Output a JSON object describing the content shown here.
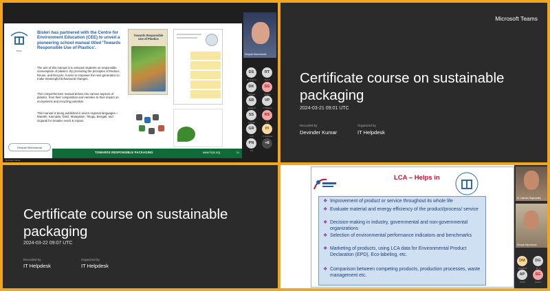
{
  "tiles": {
    "top_left": {
      "slide": {
        "logo_caption": "Bisleri",
        "headline": "Bisleri has partnered with the Centre for Environment Education (CEE) to unveil a pioneering school manual titled 'Towards Responsible Use of Plastics'.",
        "paragraph_1": "The aim of this manual is to educate students on responsible consumption of plastics. By promoting the principles of Reduce, Reuse, and Recycle, it aims to empower the next generation to make meaningful behavioural changes.",
        "paragraph_2": "This comprehensive manual delves into various aspects of plastics, from their composition and varieties to their impact on ecosystems and recycling potential.",
        "paragraph_3": "This manual is being published in seven regional languages—Marathi, Kannada, Tamil, Malayalam, Telugu, Bengali, and Gujarati for broader reach & impact.",
        "book_title": "Towards Responsible Use of Plastics",
        "presenter_tag": "Deepak Manchanda",
        "footer_title": "TOWARDS RESPONSIBLE PACKAGING",
        "footer_url": "www.f-ips.org",
        "footer_page": "34"
      },
      "camera_label": "Deepak Manchanda",
      "bottom_label": "Devinder Kumar",
      "participants": [
        {
          "initials": "DS",
          "color": "#d9d9d9",
          "text": "#333333",
          "sub": "Dr. Sharma"
        },
        {
          "initials": "RT",
          "color": "#d9d9d9",
          "text": "#333333",
          "sub": "Ravi T"
        },
        {
          "initials": "DK",
          "color": "#d9d9d9",
          "text": "#333333",
          "sub": "Devinder"
        },
        {
          "initials": "SG",
          "color": "#f2a7a7",
          "text": "#a31b1b",
          "sub": "Sunil G"
        },
        {
          "initials": "SB",
          "color": "#d9d9d9",
          "text": "#333333",
          "sub": "Sanjay B"
        },
        {
          "initials": "VP",
          "color": "#d9d9d9",
          "text": "#333333",
          "sub": "V Prakash"
        },
        {
          "initials": "SS",
          "color": "#d9d9d9",
          "text": "#333333",
          "sub": "S Singh"
        },
        {
          "initials": "RS",
          "color": "#f2a7a7",
          "text": "#a31b1b",
          "sub": "R S"
        },
        {
          "initials": "GR",
          "color": "#d9d9d9",
          "text": "#333333",
          "sub": "G R"
        },
        {
          "initials": "IH",
          "color": "#f7d9a6",
          "text": "#8a5a00",
          "sub": "IT Helpdesk"
        },
        {
          "initials": "PN",
          "color": "#d9d9d9",
          "text": "#333333",
          "sub": "P N"
        },
        {
          "initials": "+6",
          "color": "#4a4a4a",
          "text": "#ffffff",
          "sub": ""
        }
      ]
    },
    "top_right": {
      "brand": "Microsoft Teams",
      "title": "Certificate course on sustainable packaging",
      "date": "2024-03-21 09:01 UTC",
      "recorded_by_label": "Recorded by",
      "recorded_by": "Devinder Kumar",
      "organized_by_label": "Organized by",
      "organized_by": "IT Helpdesk"
    },
    "bottom_left": {
      "title": "Certificate course on sustainable packaging",
      "date": "2024-03-22 09:07 UTC",
      "recorded_by_label": "Recorded by",
      "recorded_by": "IT Helpdesk",
      "organized_by_label": "Organized by",
      "organized_by": "IT Helpdesk"
    },
    "bottom_right": {
      "slide_title": "LCA – Helps in",
      "items": [
        "Improvement of product or service throughout its whole life",
        "Evaluate material and energy efficiency of the product/process/ service",
        "Decision-making in industry, governmental and non-governmental organizations",
        "Selection of environmental performance indicators and benchmarks",
        "Marketing of products, using LCA data for Environmental Product Declaration (EPD), Eco-labeling, etc.",
        "Comparison between competing products, production processes, waste management etc."
      ],
      "camera_1_label": "Dr. Lakshmi Raghupathy",
      "camera_2_label": "Deepak Manchanda",
      "participants": [
        {
          "initials": "DM",
          "color": "#f7d9a6",
          "text": "#8a5a00",
          "sub": "Deepak M"
        },
        {
          "initials": "DG",
          "color": "#d9d9d9",
          "text": "#333333",
          "sub": "Dr. G"
        },
        {
          "initials": "AP",
          "color": "#d9d9d9",
          "text": "#333333",
          "sub": "Amit P"
        },
        {
          "initials": "SG",
          "color": "#f2a7a7",
          "text": "#a31b1b",
          "sub": "Sunil G"
        }
      ]
    }
  }
}
